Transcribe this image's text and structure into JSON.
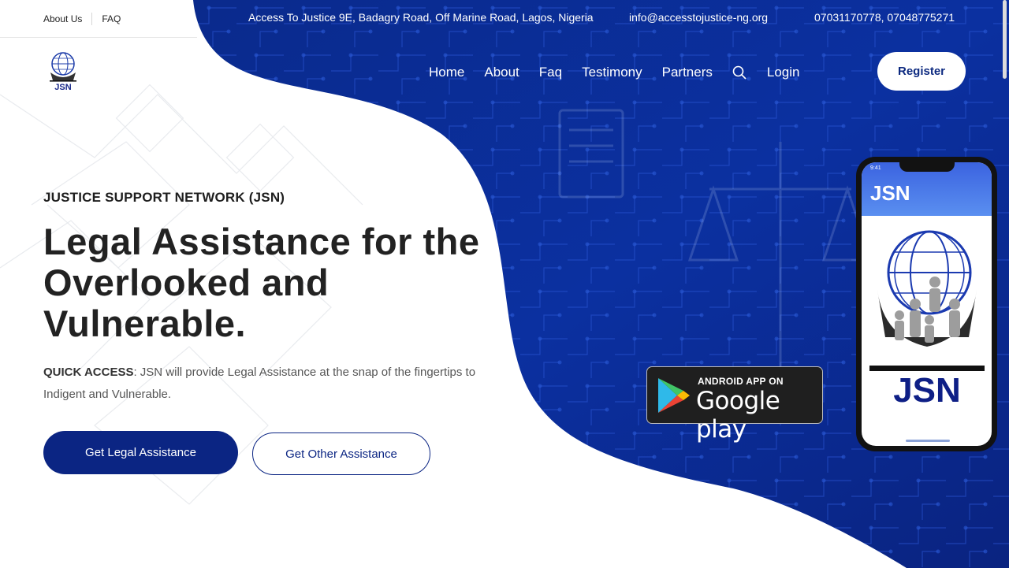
{
  "topbar": {
    "about_label": "About Us",
    "faq_label": "FAQ",
    "address": "Access To Justice 9E, Badagry Road, Off Marine Road, Lagos, Nigeria",
    "email": "info@accesstojustice-ng.org",
    "phone": "07031170778, 07048775271"
  },
  "logo": {
    "text": "JSN"
  },
  "nav": {
    "items": [
      "Home",
      "About",
      "Faq",
      "Testimony",
      "Partners"
    ],
    "login": "Login",
    "register": "Register",
    "search_icon": "search-icon"
  },
  "hero": {
    "eyebrow": "JUSTICE SUPPORT NETWORK (JSN)",
    "headline_line1": "Legal Assistance for the",
    "headline_line2": "Overlooked and",
    "headline_line3": "Vulnerable.",
    "desc_strong": "QUICK ACCESS",
    "desc_rest": ": JSN will provide Legal Assistance at the snap of the fingertips to Indigent and Vulnerable.",
    "primary_btn": "Get Legal Assistance",
    "secondary_btn": "Get Other Assistance"
  },
  "store_badge": {
    "top": "ANDROID APP ON",
    "main": "Google play"
  },
  "phone": {
    "time": "9:41",
    "title": "JSN",
    "logo_text": "JSN"
  },
  "colors": {
    "brand_blue": "#0b2583",
    "hero_blue": "#0d2a8a",
    "white": "#ffffff"
  }
}
